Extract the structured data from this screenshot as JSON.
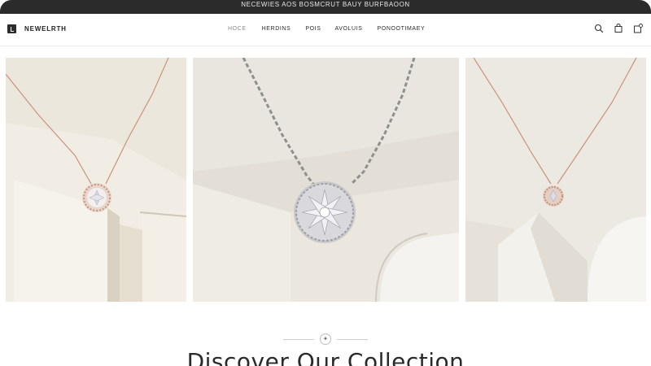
{
  "announcement": {
    "text": "NECEWIES AOS BOSMCRUT BAUY BURFBAOON"
  },
  "brand": {
    "name": "NEWELRTH"
  },
  "nav": {
    "items": [
      {
        "label": "HOCE"
      },
      {
        "label": "HERDINS"
      },
      {
        "label": "POIS"
      },
      {
        "label": "AVOLUIS"
      },
      {
        "label": "PONOOTIMAEY"
      }
    ]
  },
  "header_icons": [
    "search-icon",
    "bag-icon",
    "cart-icon"
  ],
  "gallery": [
    {
      "name": "rose-gold-flower-pendant",
      "chain_color": "#c9937a"
    },
    {
      "name": "silver-starburst-pendant",
      "chain_color": "#8f8f8f"
    },
    {
      "name": "rose-gold-solitaire-pendant",
      "chain_color": "#c9937a"
    }
  ],
  "section": {
    "ornament": "✦",
    "heading": "Discover Our Collection"
  }
}
